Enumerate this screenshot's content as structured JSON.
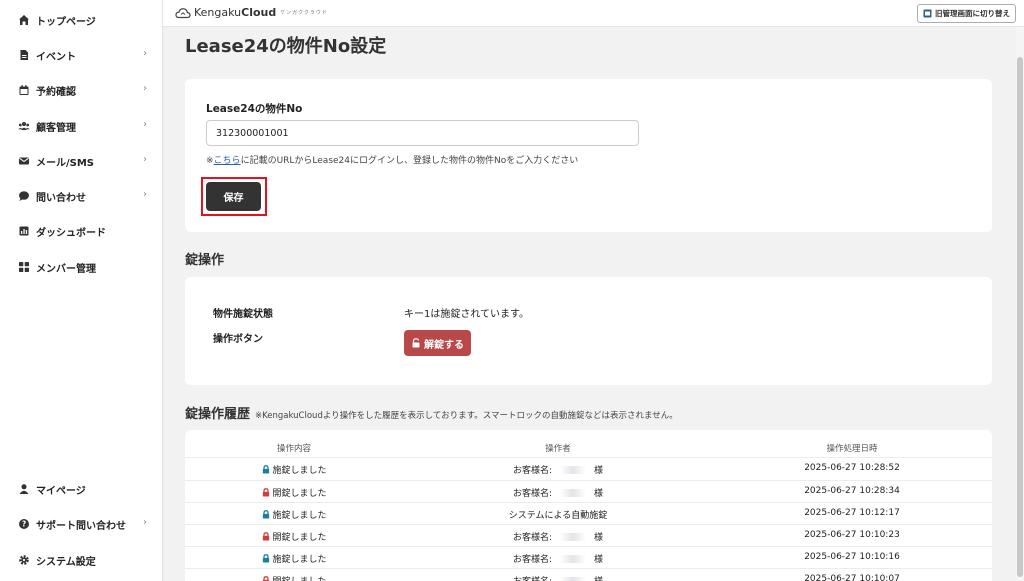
{
  "sidebar": {
    "items": [
      {
        "label": "トップページ",
        "icon": "home-icon",
        "chevron": ""
      },
      {
        "label": "イベント",
        "icon": "document-icon",
        "chevron": "›"
      },
      {
        "label": "予約確認",
        "icon": "calendar-icon",
        "chevron": "›"
      },
      {
        "label": "顧客管理",
        "icon": "users-icon",
        "chevron": "›"
      },
      {
        "label": "メール/SMS",
        "icon": "mail-icon",
        "chevron": "›"
      },
      {
        "label": "問い合わせ",
        "icon": "chat-icon",
        "chevron": "›"
      },
      {
        "label": "ダッシュボード",
        "icon": "chart-icon",
        "chevron": ""
      },
      {
        "label": "メンバー管理",
        "icon": "grid-icon",
        "chevron": ""
      }
    ],
    "bottom_items": [
      {
        "label": "マイページ",
        "icon": "user-icon",
        "chevron": ""
      },
      {
        "label": "サポート問い合わせ",
        "icon": "help-icon",
        "chevron": "›"
      },
      {
        "label": "システム設定",
        "icon": "gear-icon",
        "chevron": ""
      }
    ]
  },
  "header": {
    "logo_prefix": "Kengaku",
    "logo_suffix": "Cloud",
    "logo_sub": "ケンガククラウド",
    "switch_label": "旧管理画面に切り替え"
  },
  "page": {
    "title": "Lease24の物件No設定"
  },
  "form": {
    "label": "Lease24の物件No",
    "value": "312300001001",
    "help_prefix": "※",
    "help_link": "こちら",
    "help_suffix": "に記載のURLからLease24にログインし、登録した物件の物件Noをご入力ください",
    "save_label": "保存"
  },
  "lock": {
    "section_title": "錠操作",
    "status_label": "物件施錠状態",
    "status_value": "キー1は施錠されています。",
    "button_label": "操作ボタン",
    "unlock_label": "解錠する"
  },
  "history": {
    "section_title": "錠操作履歴",
    "note": "※KengakuCloudより操作をした履歴を表示しております。スマートロックの自動施錠などは表示されません。",
    "columns": [
      "操作内容",
      "操作者",
      "操作処理日時"
    ],
    "rows": [
      {
        "action": "施錠しました",
        "locked": true,
        "operator": "お客様名:",
        "suffix": "様",
        "time": "2025-06-27 10:28:52"
      },
      {
        "action": "開錠しました",
        "locked": false,
        "operator": "お客様名:",
        "suffix": "様",
        "time": "2025-06-27 10:28:34"
      },
      {
        "action": "施錠しました",
        "locked": true,
        "operator": "システムによる自動施錠",
        "suffix": "",
        "time": "2025-06-27 10:12:17"
      },
      {
        "action": "開錠しました",
        "locked": false,
        "operator": "お客様名:",
        "suffix": "様",
        "time": "2025-06-27 10:10:23"
      },
      {
        "action": "施錠しました",
        "locked": true,
        "operator": "お客様名:",
        "suffix": "様",
        "time": "2025-06-27 10:10:16"
      },
      {
        "action": "開錠しました",
        "locked": false,
        "operator": "お客様名:",
        "suffix": "様",
        "time": "2025-06-27 10:10:07"
      }
    ]
  },
  "colors": {
    "lock_teal": "#1a7f9a",
    "unlock_red": "#d63a3a",
    "unlock_button": "#b94848",
    "highlight": "#e0141e"
  }
}
